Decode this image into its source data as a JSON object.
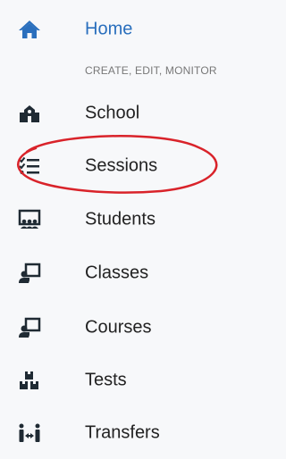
{
  "nav": {
    "home": {
      "label": "Home",
      "icon": "home-icon"
    },
    "section_header": "CREATE, EDIT, MONITOR",
    "items": [
      {
        "label": "School",
        "icon": "school-icon"
      },
      {
        "label": "Sessions",
        "icon": "checklist-icon"
      },
      {
        "label": "Students",
        "icon": "students-icon"
      },
      {
        "label": "Classes",
        "icon": "teacher-board-icon"
      },
      {
        "label": "Courses",
        "icon": "teacher-board-icon"
      },
      {
        "label": "Tests",
        "icon": "boxes-icon"
      },
      {
        "label": "Transfers",
        "icon": "transfer-icon"
      }
    ]
  },
  "colors": {
    "accent": "#2a6fbd",
    "icon_dark": "#1f2a33",
    "annotation_red": "#d9232a"
  }
}
